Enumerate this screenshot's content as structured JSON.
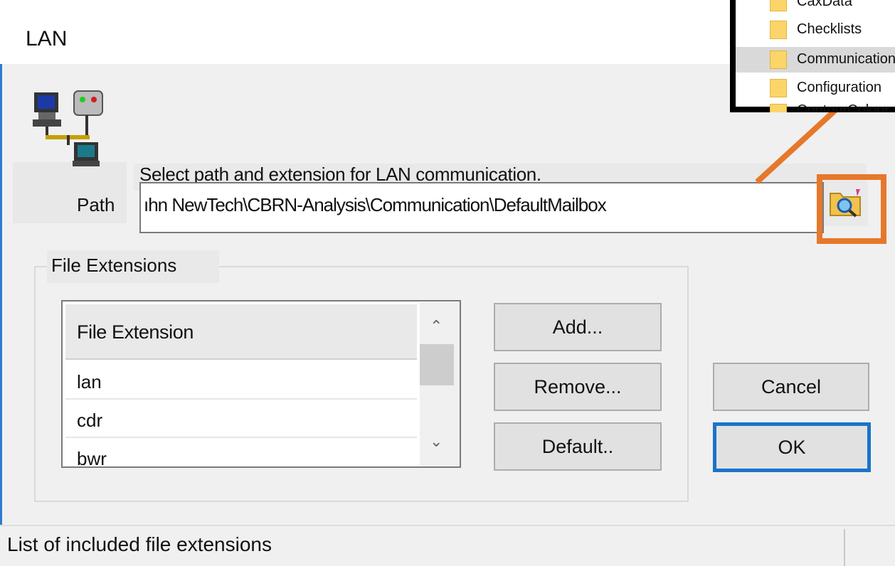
{
  "window": {
    "title": "LAN"
  },
  "instructions": "Select path and extension for LAN communication.",
  "path": {
    "label": "Path",
    "value": "ıhn NewTech\\CBRN-Analysis\\Communication\\DefaultMailbox"
  },
  "file_extensions": {
    "group_label": "File Extensions",
    "column_header": "File Extension",
    "rows": [
      "lan",
      "cdr",
      "bwr"
    ]
  },
  "buttons": {
    "add": "Add...",
    "remove": "Remove...",
    "default": "Default..",
    "cancel": "Cancel",
    "ok": "OK"
  },
  "status_bar": {
    "text": "List of included file extensions"
  },
  "explorer_overlay": {
    "folders": [
      "CaxData",
      "Checklists",
      "Communication",
      "Configuration",
      "ContourColour"
    ],
    "selected": "Communication"
  },
  "colors": {
    "highlight": "#e6782b",
    "focus": "#1a73c9",
    "folder": "#fbd56a"
  },
  "icons": [
    "network-computers-icon",
    "browse-folder-icon",
    "scroll-up-icon",
    "scroll-down-icon",
    "folder-icon"
  ]
}
